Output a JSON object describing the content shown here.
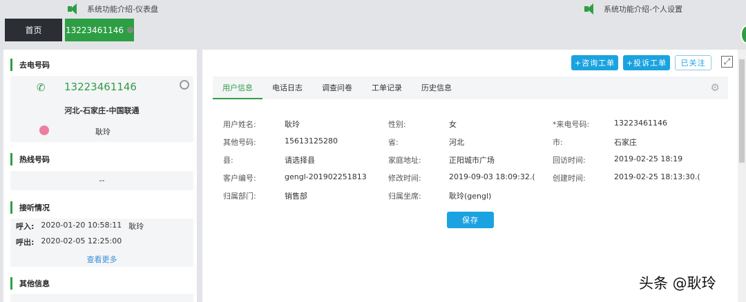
{
  "notices": [
    "系统功能介绍-仪表盘",
    "系统功能介绍-个人设置"
  ],
  "tabs": {
    "home": "首页",
    "active": "13223461146"
  },
  "left": {
    "caller_title": "去电号码",
    "phone": "13223461146",
    "location": "河北-石家庄-中国联通",
    "agent": "耿玲",
    "hotline_title": "热线号码",
    "hotline": "--",
    "calls_title": "接听情况",
    "calls": [
      {
        "label": "呼入:",
        "time": "2020-01-20 10:58:11",
        "agent": "耿玲"
      },
      {
        "label": "呼出:",
        "time": "2020-02-05 12:25:00",
        "agent": ""
      }
    ],
    "more": "查看更多",
    "other_title": "其他信息"
  },
  "actions": {
    "consult": "+咨询工单",
    "complaint": "+投诉工单",
    "followed": "已关注"
  },
  "content_tabs": [
    "用户信息",
    "电话日志",
    "调查问卷",
    "工单记录",
    "历史信息"
  ],
  "fields": [
    [
      {
        "label": "用户姓名:",
        "value": "耿玲"
      },
      {
        "label": "性别:",
        "value": "女"
      },
      {
        "label": "*来电号码:",
        "value": "13223461146"
      }
    ],
    [
      {
        "label": "其他号码:",
        "value": "15613125280"
      },
      {
        "label": "省:",
        "value": "河北"
      },
      {
        "label": "市:",
        "value": "石家庄"
      }
    ],
    [
      {
        "label": "县:",
        "value": "请选择县"
      },
      {
        "label": "家庭地址:",
        "value": "正阳城市广场"
      },
      {
        "label": "回访时间:",
        "value": "2019-02-25 18:19"
      }
    ],
    [
      {
        "label": "客户编号:",
        "value": "gengl-201902251813"
      },
      {
        "label": "修改时间:",
        "value": "2019-09-03 18:09:32.("
      },
      {
        "label": "创建时间:",
        "value": "2019-02-25 18:13:30.("
      }
    ],
    [
      {
        "label": "归属部门:",
        "value": "销售部"
      },
      {
        "label": "归属坐席:",
        "value": "耿玲(gengl)"
      }
    ]
  ],
  "save": "保存",
  "watermark": "头条 @耿玲",
  "colors": {
    "green": "#2e9e44",
    "blue": "#1aa3e0"
  }
}
